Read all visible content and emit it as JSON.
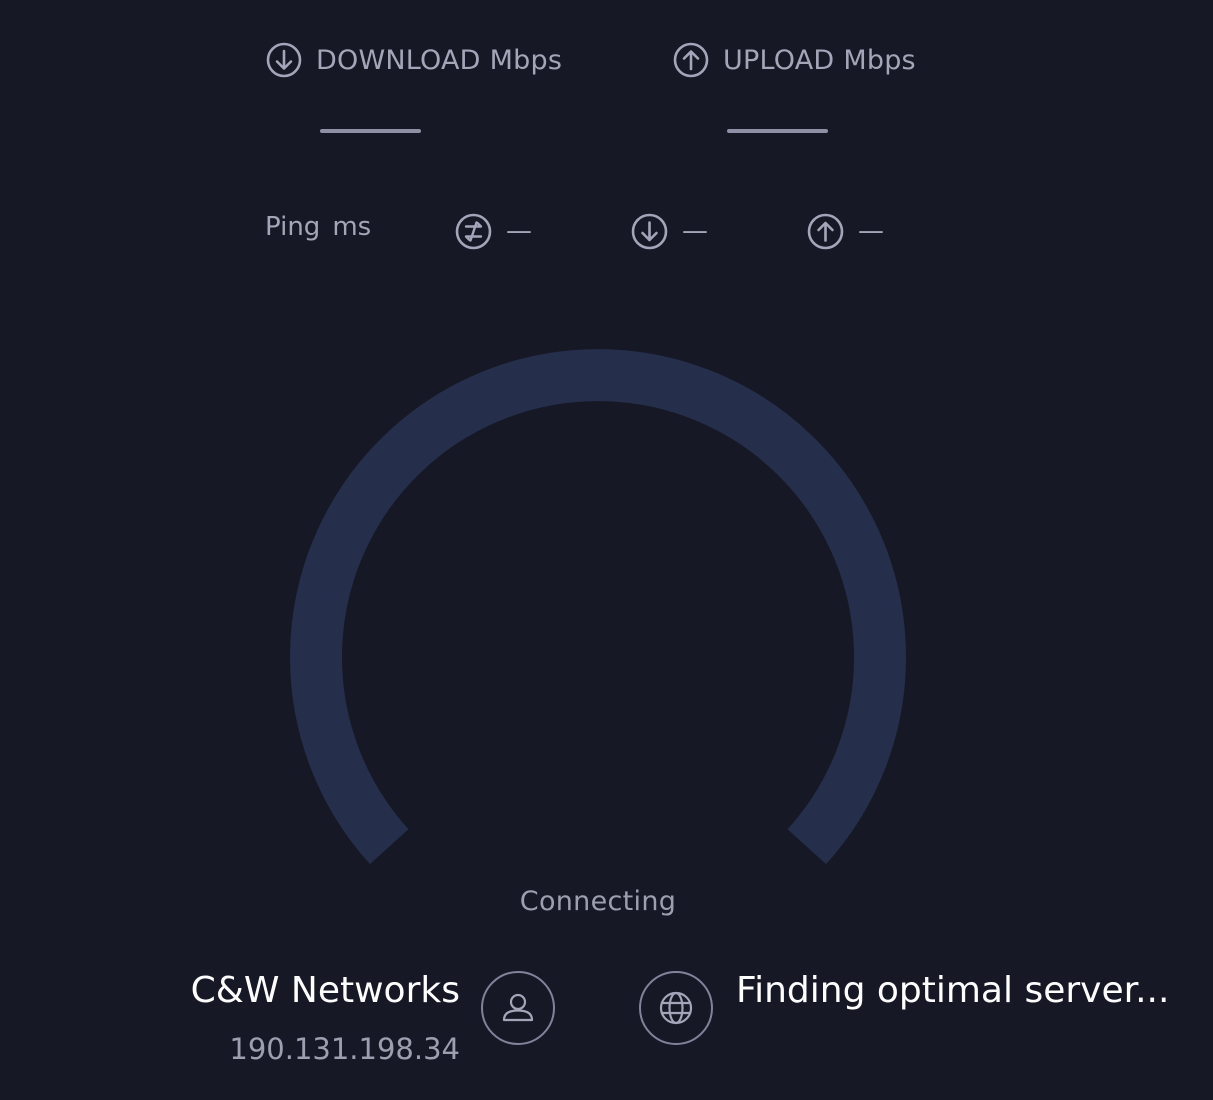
{
  "metrics": {
    "download": {
      "label": "DOWNLOAD",
      "unit": "Mbps",
      "icon": "download-arrow-icon"
    },
    "upload": {
      "label": "UPLOAD",
      "unit": "Mbps",
      "icon": "upload-arrow-icon"
    }
  },
  "ping": {
    "label": "Ping",
    "unit": "ms",
    "idle": {
      "icon": "idle-ping-icon",
      "value": "—"
    },
    "download": {
      "icon": "download-arrow-icon",
      "value": "—"
    },
    "upload": {
      "icon": "upload-arrow-icon",
      "value": "—"
    }
  },
  "gauge": {
    "status": "Connecting",
    "track_color": "#252e4a"
  },
  "provider": {
    "name": "C&W Networks",
    "ip": "190.131.198.34",
    "icon": "user-icon"
  },
  "server": {
    "name": "Finding optimal server...",
    "icon": "globe-icon"
  },
  "colors": {
    "background": "#161826",
    "text_primary": "#ffffff",
    "text_secondary": "#a3a6b8"
  }
}
